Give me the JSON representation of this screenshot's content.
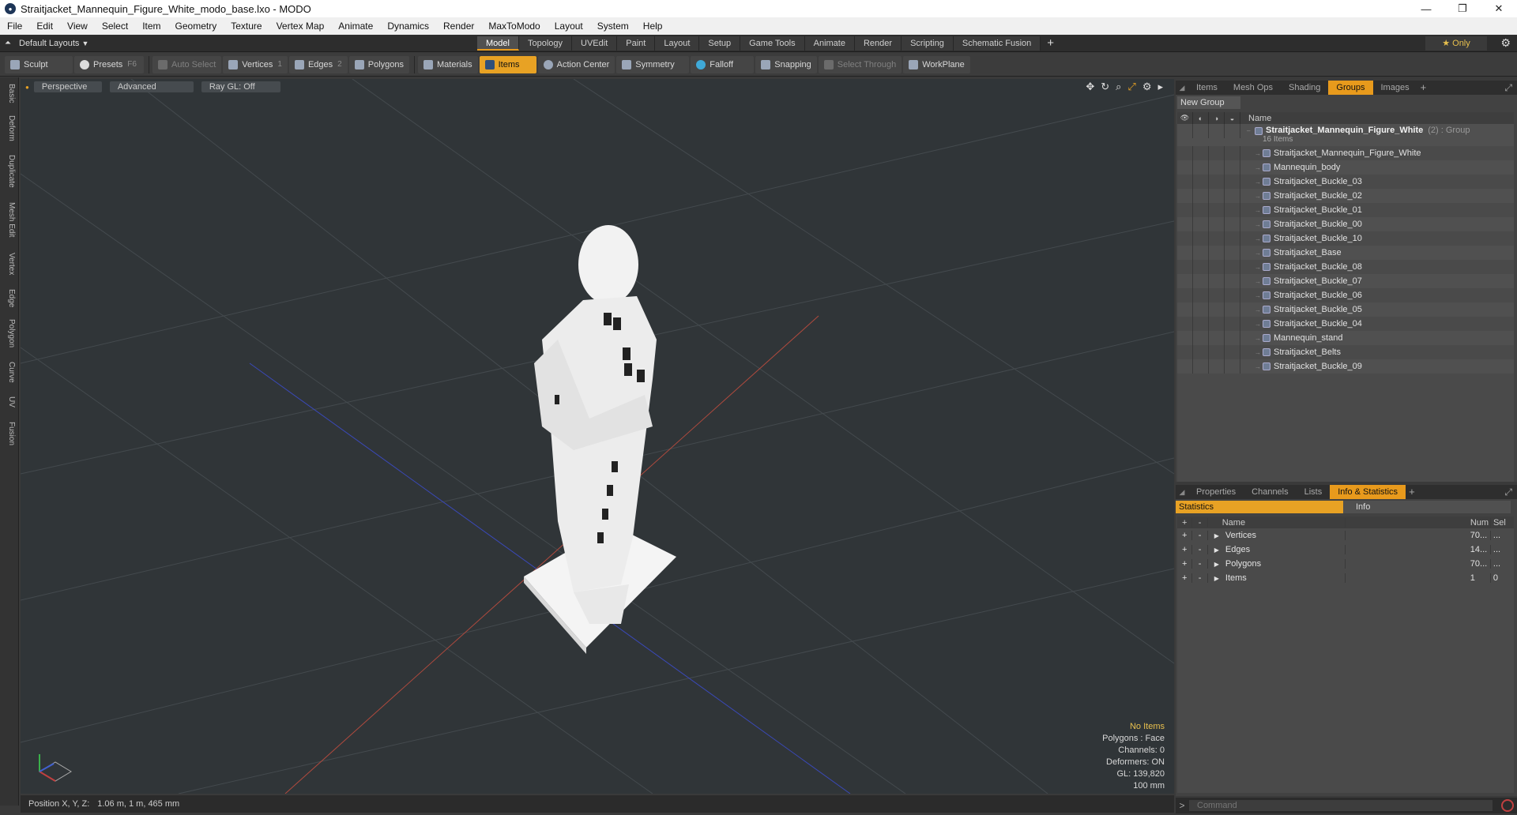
{
  "window": {
    "title": "Straitjacket_Mannequin_Figure_White_modo_base.lxo - MODO",
    "minimize": "—",
    "maximize": "❐",
    "close": "✕"
  },
  "menu": [
    "File",
    "Edit",
    "View",
    "Select",
    "Item",
    "Geometry",
    "Texture",
    "Vertex Map",
    "Animate",
    "Dynamics",
    "Render",
    "MaxToModo",
    "Layout",
    "System",
    "Help"
  ],
  "layout": {
    "name": "Default Layouts",
    "tabs": [
      "Model",
      "Topology",
      "UVEdit",
      "Paint",
      "Layout",
      "Setup",
      "Game Tools",
      "Animate",
      "Render",
      "Scripting",
      "Schematic Fusion"
    ],
    "active_tab": "Model",
    "only": "★  Only"
  },
  "toolbar": {
    "sculpt": "Sculpt",
    "presets": "Presets",
    "presets_key": "F6",
    "auto_select": "Auto Select",
    "vertices": "Vertices",
    "vertices_key": "1",
    "edges": "Edges",
    "edges_key": "2",
    "polygons": "Polygons",
    "materials": "Materials",
    "items": "Items",
    "action_center": "Action Center",
    "symmetry": "Symmetry",
    "falloff": "Falloff",
    "snapping": "Snapping",
    "select_through": "Select Through",
    "workplane": "WorkPlane"
  },
  "left_tabs": [
    "Basic",
    "Deform",
    "Duplicate",
    "Mesh Edit",
    "Vertex",
    "Edge",
    "Polygon",
    "Curve",
    "UV",
    "Fusion"
  ],
  "viewport": {
    "perspective": "Perspective",
    "advanced": "Advanced",
    "raygl": "Ray GL: Off",
    "info": {
      "no_items": "No Items",
      "polygons": "Polygons : Face",
      "channels": "Channels: 0",
      "deformers": "Deformers: ON",
      "gl": "GL: 139,820",
      "scale": "100 mm"
    }
  },
  "status": {
    "label": "Position X, Y, Z:",
    "value": "1.06 m, 1 m, 465 mm"
  },
  "groups_panel": {
    "tabs": [
      "Items",
      "Mesh Ops",
      "Shading",
      "Groups",
      "Images"
    ],
    "active_tab": "Groups",
    "new_group": "New Group",
    "col_name": "Name",
    "root": {
      "name": "Straitjacket_Mannequin_Figure_White",
      "count": "(2) : Group",
      "items": "16 Items"
    },
    "children": [
      "Straitjacket_Mannequin_Figure_White",
      "Mannequin_body",
      "Straitjacket_Buckle_03",
      "Straitjacket_Buckle_02",
      "Straitjacket_Buckle_01",
      "Straitjacket_Buckle_00",
      "Straitjacket_Buckle_10",
      "Straitjacket_Base",
      "Straitjacket_Buckle_08",
      "Straitjacket_Buckle_07",
      "Straitjacket_Buckle_06",
      "Straitjacket_Buckle_05",
      "Straitjacket_Buckle_04",
      "Mannequin_stand",
      "Straitjacket_Belts",
      "Straitjacket_Buckle_09"
    ]
  },
  "stats_panel": {
    "tabs": [
      "Properties",
      "Channels",
      "Lists",
      "Info & Statistics"
    ],
    "active_tab": "Info & Statistics",
    "statistics": "Statistics",
    "info": "Info",
    "headers": {
      "name": "Name",
      "num": "Num",
      "sel": "Sel"
    },
    "rows": [
      {
        "name": "Vertices",
        "num": "70...",
        "sel": "..."
      },
      {
        "name": "Edges",
        "num": "14...",
        "sel": "..."
      },
      {
        "name": "Polygons",
        "num": "70...",
        "sel": "..."
      },
      {
        "name": "Items",
        "num": "1",
        "sel": "0"
      }
    ]
  },
  "command": {
    "placeholder": "Command"
  }
}
